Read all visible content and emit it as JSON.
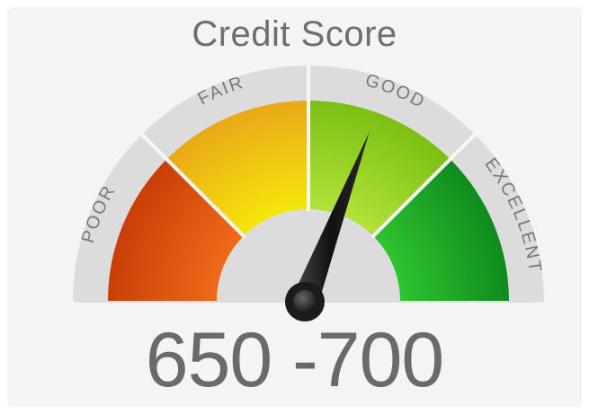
{
  "title": "Credit Score",
  "range_label": "650 -700",
  "segments": [
    {
      "label": "POOR",
      "color": "#ee5a12"
    },
    {
      "label": "FAIR",
      "color": "#f2cf10"
    },
    {
      "label": "GOOD",
      "color": "#9ed321"
    },
    {
      "label": "EXCELLENT",
      "color": "#1ea52a"
    }
  ],
  "needle_level": 0.61,
  "colors": {
    "background": "#f4f4f4",
    "band": "#dcdcdc",
    "needle": "#1c1c1c",
    "text": "#6e6e6e"
  }
}
